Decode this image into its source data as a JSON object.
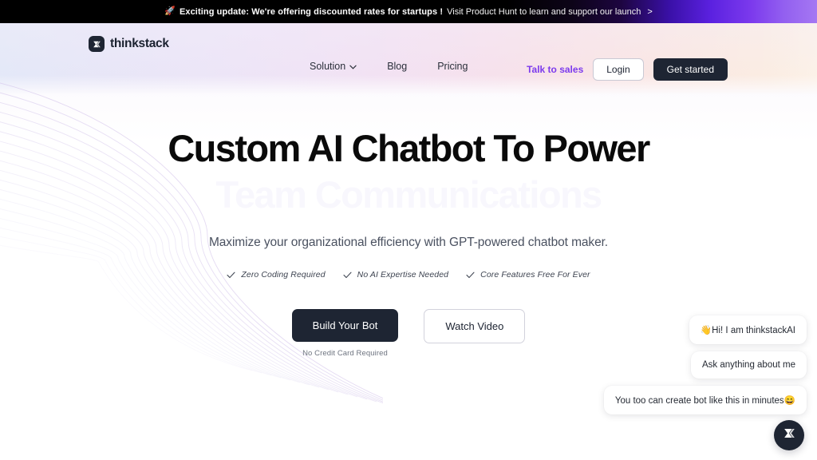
{
  "banner": {
    "rocket_icon": "rocket-icon",
    "emphasis": "Exciting update: We're offering discounted rates for startups !",
    "rest": "Visit Product Hunt to learn and support our launch",
    "arrow": ">"
  },
  "nav": {
    "logo": {
      "name": "thinkstack",
      "mark_icon": "thinkstack-arrow-icon"
    },
    "links": [
      {
        "label": "Solution",
        "has_chevron": true
      },
      {
        "label": "Blog",
        "has_chevron": false
      },
      {
        "label": "Pricing",
        "has_chevron": false
      }
    ],
    "talk_to_sales": "Talk to sales",
    "login": "Login",
    "get_started": "Get started",
    "accent_color": "#7c3aed",
    "dark_color": "#1e2533"
  },
  "hero": {
    "headline": "Custom AI Chatbot To Power",
    "headline_rotating": "Team Communications",
    "subtitle": "Maximize your organizational efficiency with GPT-powered chatbot maker.",
    "features": [
      "Zero Coding Required",
      "No AI Expertise Needed",
      "Core Features Free For Ever"
    ],
    "primary_cta": "Build Your Bot",
    "primary_cta_note": "No Credit Card Required",
    "secondary_cta": "Watch Video"
  },
  "chat_widget": {
    "messages": [
      "👋Hi! I am thinkstackAI",
      "Ask anything about me",
      "You too can create bot like this in minutes😄"
    ],
    "launcher_icon": "thinkstack-arrow-icon"
  }
}
